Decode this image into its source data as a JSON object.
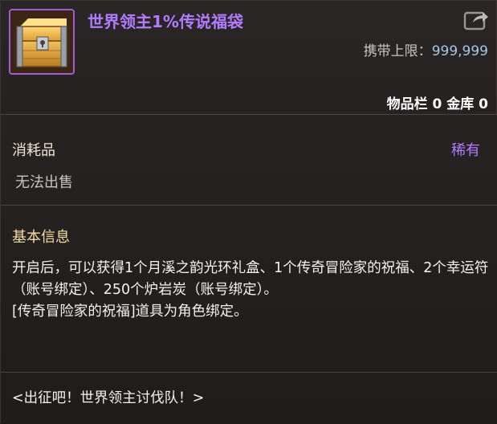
{
  "item": {
    "name": "世界领主1%传说福袋",
    "icon": "treasure-chest-icon",
    "rarity_color": "#b27cff"
  },
  "header": {
    "carry_limit_label": "携带上限：",
    "carry_limit_value": "999,999",
    "storage_text": "物品栏 0 金库 0",
    "share_icon": "share-icon"
  },
  "info": {
    "type": "消耗品",
    "rarity": "稀有",
    "sell_status": "无法出售"
  },
  "basic_info": {
    "title": "基本信息",
    "lines": [
      "开启后，可以获得1个月溪之韵光环礼盒、1个传奇冒险家的祝福、2个幸运符（账号绑定）、250个炉岩炭（账号绑定）。",
      "[传奇冒险家的祝福]道具为角色绑定。"
    ],
    "flavor_text": "<出征吧！世界领主讨伐队！>"
  }
}
